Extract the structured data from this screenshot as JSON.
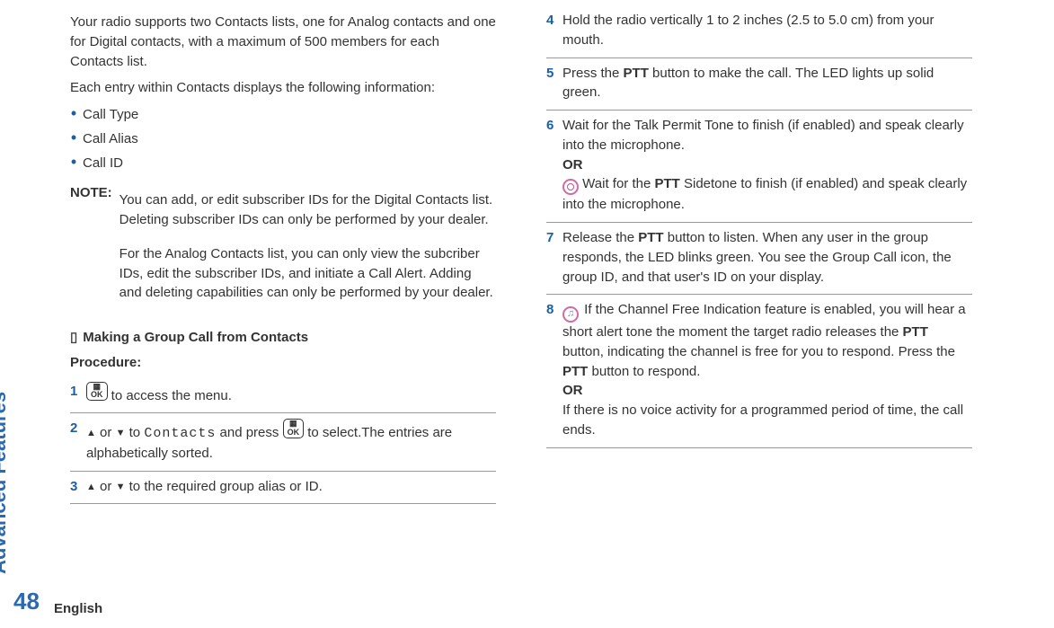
{
  "side_label": "Advanced Features",
  "page_number": "48",
  "language": "English",
  "intro": {
    "p1": "Your radio supports two Contacts lists, one for Analog contacts and one for Digital contacts, with a maximum of 500 members for each Contacts list.",
    "p2": "Each entry within Contacts displays the following information:",
    "bullets": [
      "Call Type",
      "Call Alias",
      "Call ID"
    ],
    "note_label": "NOTE:",
    "note_p1": "You can add, or edit subscriber IDs for the Digital Contacts list. Deleting subscriber IDs can only be performed by your dealer.",
    "note_p2": "For the Analog Contacts list, you can only view the subcriber IDs, edit the subscriber IDs, and initiate a Call Alert. Adding and deleting capabilities can only be performed by your dealer."
  },
  "section_title": "Making a Group Call from Contacts",
  "procedure_label": "Procedure:",
  "steps_left": [
    {
      "n": "1",
      "t_after_icon": " to access the menu."
    },
    {
      "n": "2",
      "t_prefix": "",
      "or": " or ",
      "to": " to ",
      "menu": "Contacts",
      "and_press": " and press ",
      "t_after_icon": " to select.The entries are alphabetically sorted."
    },
    {
      "n": "3",
      "t_prefix": "",
      "or": " or ",
      "tail": " to the required group alias or ID."
    }
  ],
  "steps_right": [
    {
      "n": "4",
      "body": "Hold the radio vertically 1 to 2 inches (2.5 to 5.0 cm) from your mouth."
    },
    {
      "n": "5",
      "pre": "Press the ",
      "b1": "PTT",
      "post": " button to make the call. The LED lights up solid green."
    },
    {
      "n": "6",
      "line1": "Wait for the Talk Permit Tone to finish (if enabled) and speak clearly into the microphone.",
      "or": "OR",
      "wait_for": " Wait for the ",
      "b1": "PTT",
      "after": " Sidetone to finish (if enabled) and speak clearly into the microphone."
    },
    {
      "n": "7",
      "pre": "Release the ",
      "b1": "PTT",
      "post": " button to listen. When any user in the group responds, the LED blinks green. You see the Group Call icon, the group ID, and that user's ID on your display."
    },
    {
      "n": "8",
      "seg1": " If the Channel Free Indication feature is enabled, you will hear a short alert tone the moment the target radio releases the ",
      "b1": "PTT",
      "seg2": " button, indicating the channel is free for you to respond. Press the ",
      "b2": "PTT",
      "seg3": " button to respond.",
      "or": "OR",
      "alt": "If there is no voice activity for a programmed period of time, the call ends."
    }
  ]
}
